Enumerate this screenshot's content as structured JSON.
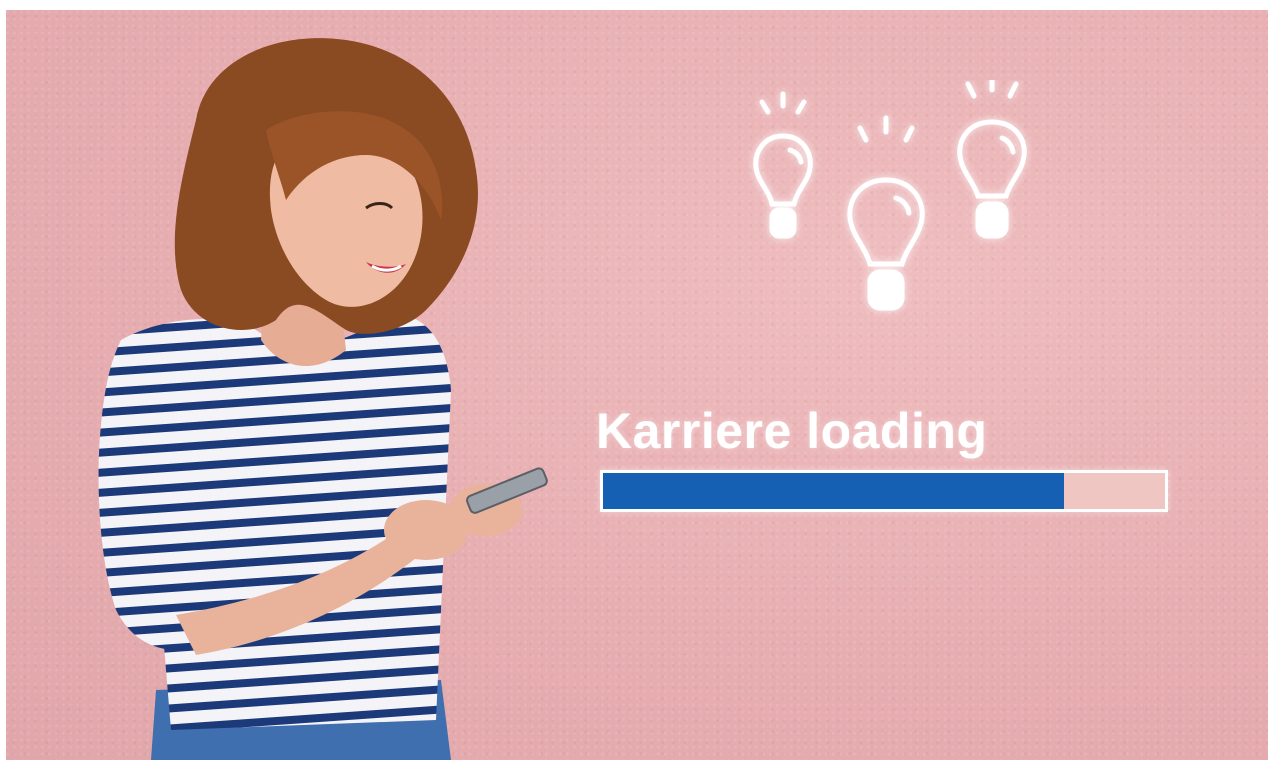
{
  "headline": "Karriere loading",
  "progress": {
    "fraction": 0.82,
    "fill_color": "#1560b3",
    "track_color": "#efc6c2"
  },
  "background_color": "#e9b1b5",
  "icons": [
    "lightbulb-icon",
    "lightbulb-icon",
    "lightbulb-icon"
  ],
  "photo": {
    "subject": "woman-with-smartphone"
  }
}
